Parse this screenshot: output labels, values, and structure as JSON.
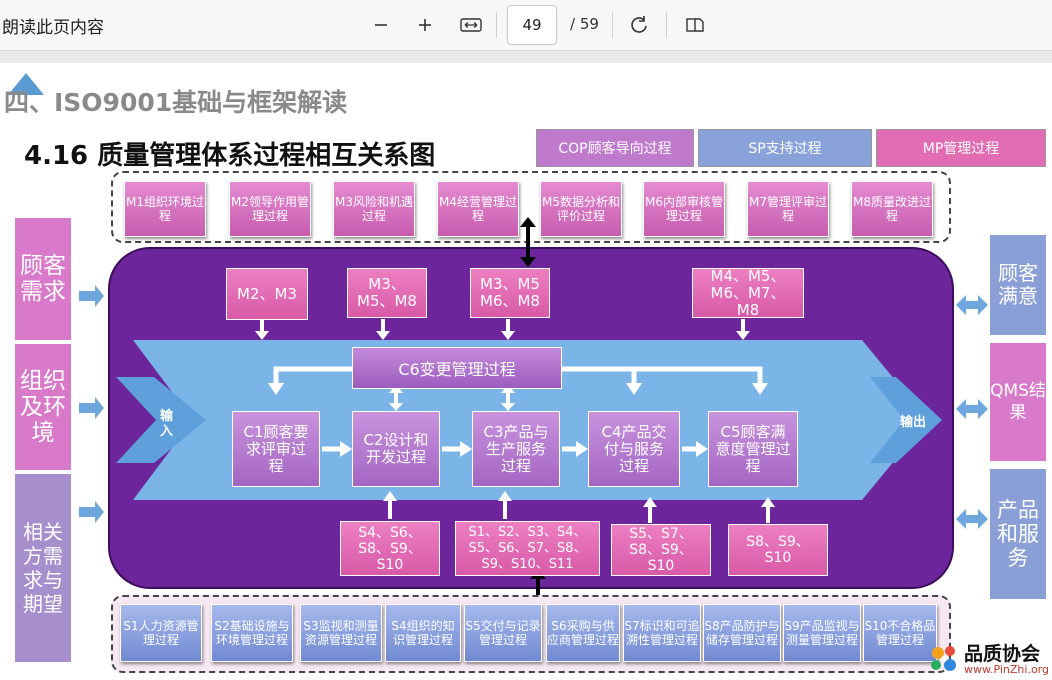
{
  "toolbar": {
    "read_aloud": "朗读此页内容",
    "current_page": "49",
    "total_pages": "/ 59"
  },
  "slide": {
    "section_title": "四、ISO9001基础与框架解读",
    "title": "4.16 质量管理体系过程相互关系图",
    "legend": {
      "cop": "COP顾客导向过程",
      "sp": "SP支持过程",
      "mp": "MP管理过程"
    },
    "management": [
      "M1组织环境过程",
      "M2领导作用管理过程",
      "M3风险和机遇过程",
      "M4经营管理过程",
      "M5数据分析和评价过程",
      "M6内部审核管理过程",
      "M7管理评审过程",
      "M8质量改进过程"
    ],
    "support": [
      "S1人力资源管理过程",
      "S2基础设施与环境管理过程",
      "S3监视和测量资源管理过程",
      "S4组织的知识管理过程",
      "S5交付与记录管理过程",
      "S6采购与供应商管理过程",
      "S7标识和可追溯性管理过程",
      "S8产品防护与储存管理过程",
      "S9产品监视与测量管理过程",
      "S10不合格品管理过程"
    ],
    "left_inputs": [
      "顾客需求",
      "组织及环境",
      "相关方需求与期望"
    ],
    "right_outputs": [
      "顾客满意",
      "QMS结果",
      "产品和服务"
    ],
    "m_groups": [
      "M2、M3",
      "M3、M5、M8",
      "M3、M5 M6、M8",
      "M4、M5、M6、M7、M8"
    ],
    "change_process": "C6变更管理过程",
    "core": [
      "C1顾客要求评审过程",
      "C2设计和开发过程",
      "C3产品与生产服务过程",
      "C4产品交付与服务过程",
      "C5顾客满意度管理过程"
    ],
    "s_groups": [
      "S4、S6、S8、S9、S10",
      "S1、S2、S3、S4、S5、S6、S7、S8、S9、S10、S11",
      "S5、S7、S8、S9、S10",
      "S8、S9、S10"
    ],
    "input_label": "输入",
    "output_label": "输出"
  },
  "logo": {
    "name": "品质协会",
    "url": "www.PinZhi.org"
  },
  "colors": {
    "core_band": "#6c259a",
    "management": "#c65cae",
    "support": "#7189d2",
    "chevron": "#7bb5e8"
  }
}
